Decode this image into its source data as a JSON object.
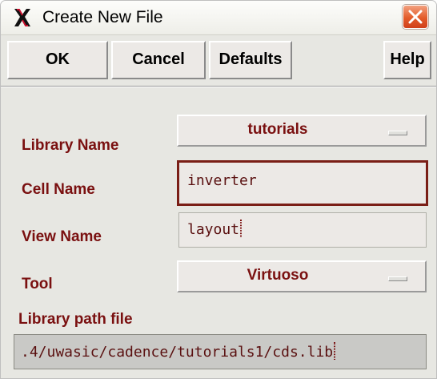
{
  "window": {
    "title": "Create New File"
  },
  "buttons": {
    "ok": "OK",
    "cancel": "Cancel",
    "defaults": "Defaults",
    "help": "Help"
  },
  "form": {
    "library_name": {
      "label": "Library Name",
      "value": "tutorials"
    },
    "cell_name": {
      "label": "Cell Name",
      "value": "inverter"
    },
    "view_name": {
      "label": "View Name",
      "value": "layout"
    },
    "tool": {
      "label": "Tool",
      "value": "Virtuoso"
    },
    "library_path_file": {
      "label": "Library path file",
      "value": ".4/uwasic/cadence/tutorials1/cds.lib"
    }
  },
  "colors": {
    "label_text": "#7a1010",
    "dialog_background": "#e7e7e2",
    "close_button": "#e35b2a"
  },
  "icons": {
    "title_icon": "cadence-x-icon",
    "close_icon": "close-icon",
    "cyclic_indicator": "cyclic-field-indicator-icon"
  }
}
